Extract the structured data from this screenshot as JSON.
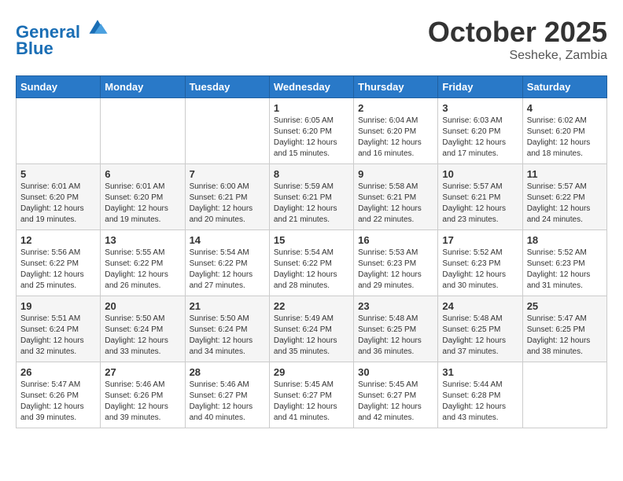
{
  "header": {
    "logo_line1": "General",
    "logo_line2": "Blue",
    "month": "October 2025",
    "location": "Sesheke, Zambia"
  },
  "weekdays": [
    "Sunday",
    "Monday",
    "Tuesday",
    "Wednesday",
    "Thursday",
    "Friday",
    "Saturday"
  ],
  "weeks": [
    [
      {
        "day": "",
        "info": ""
      },
      {
        "day": "",
        "info": ""
      },
      {
        "day": "",
        "info": ""
      },
      {
        "day": "1",
        "info": "Sunrise: 6:05 AM\nSunset: 6:20 PM\nDaylight: 12 hours\nand 15 minutes."
      },
      {
        "day": "2",
        "info": "Sunrise: 6:04 AM\nSunset: 6:20 PM\nDaylight: 12 hours\nand 16 minutes."
      },
      {
        "day": "3",
        "info": "Sunrise: 6:03 AM\nSunset: 6:20 PM\nDaylight: 12 hours\nand 17 minutes."
      },
      {
        "day": "4",
        "info": "Sunrise: 6:02 AM\nSunset: 6:20 PM\nDaylight: 12 hours\nand 18 minutes."
      }
    ],
    [
      {
        "day": "5",
        "info": "Sunrise: 6:01 AM\nSunset: 6:20 PM\nDaylight: 12 hours\nand 19 minutes."
      },
      {
        "day": "6",
        "info": "Sunrise: 6:01 AM\nSunset: 6:20 PM\nDaylight: 12 hours\nand 19 minutes."
      },
      {
        "day": "7",
        "info": "Sunrise: 6:00 AM\nSunset: 6:21 PM\nDaylight: 12 hours\nand 20 minutes."
      },
      {
        "day": "8",
        "info": "Sunrise: 5:59 AM\nSunset: 6:21 PM\nDaylight: 12 hours\nand 21 minutes."
      },
      {
        "day": "9",
        "info": "Sunrise: 5:58 AM\nSunset: 6:21 PM\nDaylight: 12 hours\nand 22 minutes."
      },
      {
        "day": "10",
        "info": "Sunrise: 5:57 AM\nSunset: 6:21 PM\nDaylight: 12 hours\nand 23 minutes."
      },
      {
        "day": "11",
        "info": "Sunrise: 5:57 AM\nSunset: 6:22 PM\nDaylight: 12 hours\nand 24 minutes."
      }
    ],
    [
      {
        "day": "12",
        "info": "Sunrise: 5:56 AM\nSunset: 6:22 PM\nDaylight: 12 hours\nand 25 minutes."
      },
      {
        "day": "13",
        "info": "Sunrise: 5:55 AM\nSunset: 6:22 PM\nDaylight: 12 hours\nand 26 minutes."
      },
      {
        "day": "14",
        "info": "Sunrise: 5:54 AM\nSunset: 6:22 PM\nDaylight: 12 hours\nand 27 minutes."
      },
      {
        "day": "15",
        "info": "Sunrise: 5:54 AM\nSunset: 6:22 PM\nDaylight: 12 hours\nand 28 minutes."
      },
      {
        "day": "16",
        "info": "Sunrise: 5:53 AM\nSunset: 6:23 PM\nDaylight: 12 hours\nand 29 minutes."
      },
      {
        "day": "17",
        "info": "Sunrise: 5:52 AM\nSunset: 6:23 PM\nDaylight: 12 hours\nand 30 minutes."
      },
      {
        "day": "18",
        "info": "Sunrise: 5:52 AM\nSunset: 6:23 PM\nDaylight: 12 hours\nand 31 minutes."
      }
    ],
    [
      {
        "day": "19",
        "info": "Sunrise: 5:51 AM\nSunset: 6:24 PM\nDaylight: 12 hours\nand 32 minutes."
      },
      {
        "day": "20",
        "info": "Sunrise: 5:50 AM\nSunset: 6:24 PM\nDaylight: 12 hours\nand 33 minutes."
      },
      {
        "day": "21",
        "info": "Sunrise: 5:50 AM\nSunset: 6:24 PM\nDaylight: 12 hours\nand 34 minutes."
      },
      {
        "day": "22",
        "info": "Sunrise: 5:49 AM\nSunset: 6:24 PM\nDaylight: 12 hours\nand 35 minutes."
      },
      {
        "day": "23",
        "info": "Sunrise: 5:48 AM\nSunset: 6:25 PM\nDaylight: 12 hours\nand 36 minutes."
      },
      {
        "day": "24",
        "info": "Sunrise: 5:48 AM\nSunset: 6:25 PM\nDaylight: 12 hours\nand 37 minutes."
      },
      {
        "day": "25",
        "info": "Sunrise: 5:47 AM\nSunset: 6:25 PM\nDaylight: 12 hours\nand 38 minutes."
      }
    ],
    [
      {
        "day": "26",
        "info": "Sunrise: 5:47 AM\nSunset: 6:26 PM\nDaylight: 12 hours\nand 39 minutes."
      },
      {
        "day": "27",
        "info": "Sunrise: 5:46 AM\nSunset: 6:26 PM\nDaylight: 12 hours\nand 39 minutes."
      },
      {
        "day": "28",
        "info": "Sunrise: 5:46 AM\nSunset: 6:27 PM\nDaylight: 12 hours\nand 40 minutes."
      },
      {
        "day": "29",
        "info": "Sunrise: 5:45 AM\nSunset: 6:27 PM\nDaylight: 12 hours\nand 41 minutes."
      },
      {
        "day": "30",
        "info": "Sunrise: 5:45 AM\nSunset: 6:27 PM\nDaylight: 12 hours\nand 42 minutes."
      },
      {
        "day": "31",
        "info": "Sunrise: 5:44 AM\nSunset: 6:28 PM\nDaylight: 12 hours\nand 43 minutes."
      },
      {
        "day": "",
        "info": ""
      }
    ]
  ]
}
